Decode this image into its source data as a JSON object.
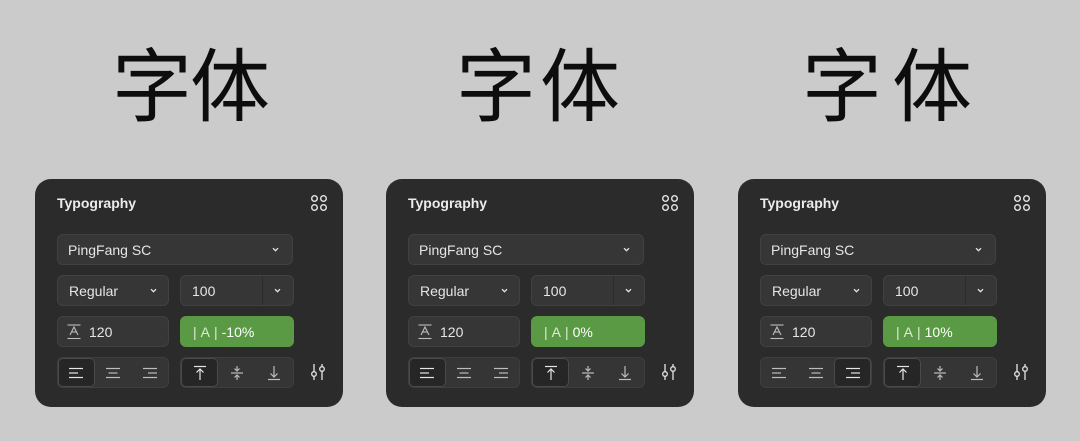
{
  "glyph_text": "字体",
  "panels": [
    {
      "title": "Typography",
      "font_family": "PingFang SC",
      "font_weight": "Regular",
      "font_size": "100",
      "line_height": "120",
      "letter_spacing": "-10%",
      "letter_spacing_prefix": "A",
      "text_align_active": "left",
      "vertical_align_active": "top"
    },
    {
      "title": "Typography",
      "font_family": "PingFang SC",
      "font_weight": "Regular",
      "font_size": "100",
      "line_height": "120",
      "letter_spacing": "0%",
      "letter_spacing_prefix": "A",
      "text_align_active": "left",
      "vertical_align_active": "top"
    },
    {
      "title": "Typography",
      "font_family": "PingFang SC",
      "font_weight": "Regular",
      "font_size": "100",
      "line_height": "120",
      "letter_spacing": "10%",
      "letter_spacing_prefix": "A",
      "text_align_active": "right",
      "vertical_align_active": "top"
    }
  ],
  "icons": {
    "more": "four-dots-icon",
    "chevron": "chevron-down-icon",
    "line_height": "line-height-icon",
    "align": [
      "align-left-icon",
      "align-center-icon",
      "align-right-icon"
    ],
    "valign": [
      "align-top-icon",
      "align-middle-icon",
      "align-bottom-icon"
    ],
    "settings": "sliders-icon"
  },
  "colors": {
    "background": "#cbcbcb",
    "panel": "#2b2b2b",
    "field": "#363636",
    "accent_green": "#5a9a45"
  }
}
